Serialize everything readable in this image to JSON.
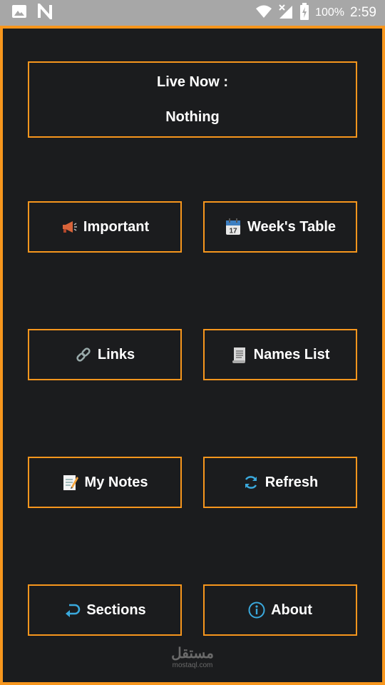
{
  "status_bar": {
    "battery": "100%",
    "time": "2:59"
  },
  "live": {
    "title": "Live Now :",
    "value": "Nothing"
  },
  "buttons": [
    {
      "label": "Important",
      "icon": "megaphone-icon"
    },
    {
      "label": "Week's Table",
      "icon": "calendar-icon"
    },
    {
      "label": "Links",
      "icon": "link-icon"
    },
    {
      "label": "Names List",
      "icon": "scroll-icon"
    },
    {
      "label": "My Notes",
      "icon": "memo-icon"
    },
    {
      "label": "Refresh",
      "icon": "refresh-icon"
    },
    {
      "label": "Sections",
      "icon": "return-arrow-icon"
    },
    {
      "label": "About",
      "icon": "info-icon"
    }
  ],
  "watermark": {
    "arabic": "مستقل",
    "latin": "mostaql.com"
  },
  "colors": {
    "accent": "#f7961d",
    "background": "#1b1c1e",
    "status_bar": "#a7a7a7",
    "icon_blue": "#3aa9dd"
  }
}
